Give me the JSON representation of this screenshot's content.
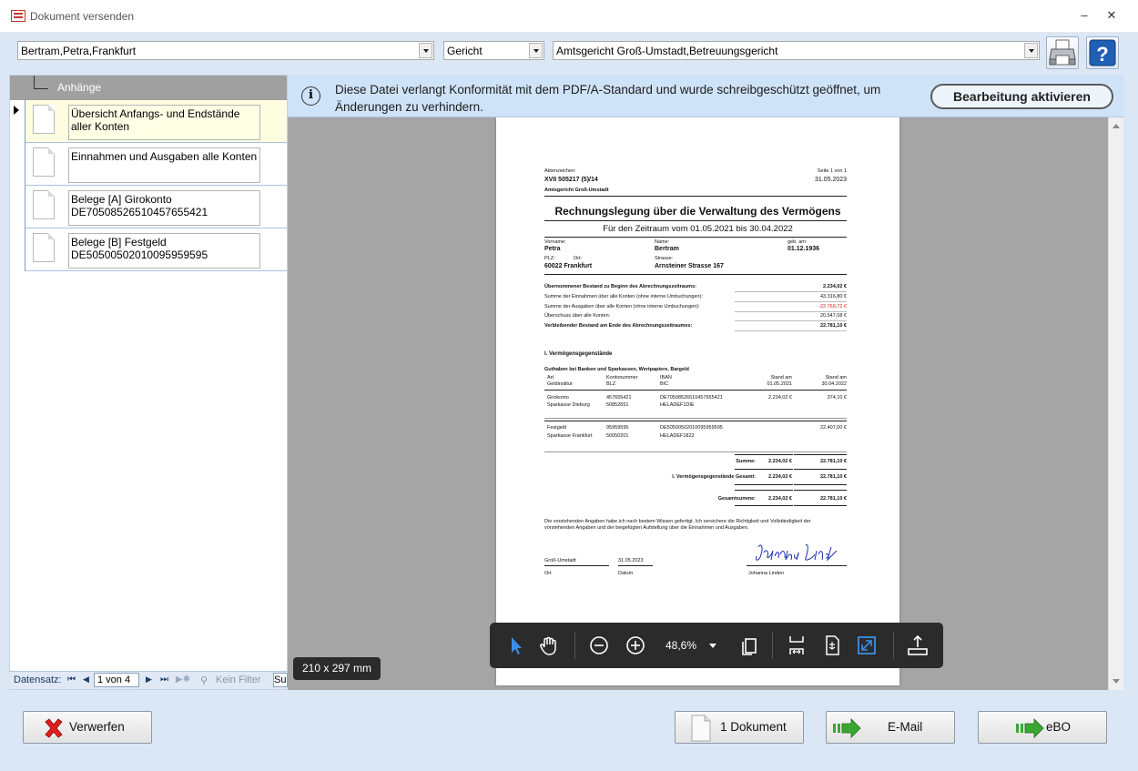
{
  "window": {
    "title": "Dokument versenden",
    "minimize": "–",
    "close": "✕"
  },
  "top": {
    "person": "Bertram,Petra,Frankfurt",
    "type": "Gericht",
    "court": "Amtsgericht Groß-Umstadt,Betreuungsgericht"
  },
  "attachments": {
    "header": "Anhänge",
    "items": [
      {
        "label": "Übersicht Anfangs- und Endstände aller Konten"
      },
      {
        "label": "Einnahmen und Ausgaben alle Konten"
      },
      {
        "label": "Belege [A] Girokonto DE70508526510457655421"
      },
      {
        "label": "Belege [B] Festgeld DE50500502010095959595"
      }
    ]
  },
  "navigator": {
    "label": "Datensatz:",
    "position": "1 von 4",
    "filter": "Kein Filter",
    "search": "Su"
  },
  "info": {
    "message": "Diese Datei verlangt Konformität mit dem PDF/A-Standard und wurde schreibgeschützt geöffnet, um Änderungen zu verhindern.",
    "button": "Bearbeitung aktivieren"
  },
  "viewer": {
    "page_size": "210 x 297 mm",
    "zoom": "48,6%"
  },
  "document": {
    "ref_label": "Aktenzeichen:",
    "ref": "XVII 505217 (5)/14",
    "court": "Amtsgericht Groß-Umstadt",
    "page": "Seite 1 von 1",
    "date": "31.05.2023",
    "title": "Rechnungslegung über die Verwaltung des Vermögens",
    "period": "Für den Zeitraum vom 01.05.2021 bis 30.04.2022",
    "first_name_label": "Vorname:",
    "first_name": "Petra",
    "last_name_label": "Name:",
    "last_name": "Bertram",
    "birth_label": "geb. am:",
    "birth": "01.12.1936",
    "plz_label": "PLZ:",
    "ort_label": "Ort:",
    "street_label": "Strasse:",
    "plz_city": "60022   Frankfurt",
    "street": "Arnsteiner Strasse 167",
    "summary": [
      {
        "label": "Übernommener Bestand zu Beginn des Abrechnungszeitraums:",
        "value": "2.234,02 €",
        "bold": true,
        "red": false
      },
      {
        "label": "Summe der Einnahmen über alle Konten (ohne interne Umbuchungen):",
        "value": "43.316,80 €",
        "bold": false,
        "red": false
      },
      {
        "label": "Summe der Ausgaben über alle Konten (ohne interne Umbuchungen):",
        "value": "-22.769,72 €",
        "bold": false,
        "red": true
      },
      {
        "label": "Überschuss über alle Konten:",
        "value": "20.547,08 €",
        "bold": false,
        "red": false
      },
      {
        "label": "Verbleibender Bestand am Ende des Abrechnungszeitraumes:",
        "value": "22.781,10 €",
        "bold": true,
        "red": false
      }
    ],
    "section1": "I. Vermögensgegenstände",
    "section1_sub": "Guthaben bei Banken und Sparkassen, Wertpapiere, Bargeld",
    "col_art": "Art",
    "col_institute": "Geldinstitut",
    "col_account": "Kontonummer",
    "col_blz": "BLZ",
    "col_iban": "IBAN",
    "col_bic": "BIC",
    "col_stand1": "Stand am",
    "col_date1": "01.05.2021",
    "col_stand2": "Stand am",
    "col_date2": "30.04.2022",
    "acc1": {
      "type": "Girokonto",
      "bank": "Sparkasse Dieburg",
      "number": "457655421",
      "blz": "50852651",
      "iban": "DE70508526510457655421",
      "bic": "HELADEF1DIE",
      "start": "2.234,02 €",
      "end": "374,10 €"
    },
    "acc2": {
      "type": "Festgeld",
      "bank": "Sparkasse Frankfurt",
      "number": "95959595",
      "blz": "50050201",
      "iban": "DE50500502010095959595",
      "bic": "HELADEF1822",
      "start": "",
      "end": "22.407,00 €"
    },
    "sum_label": "Summe:",
    "sum_start": "2.234,02 €",
    "sum_end": "22.781,10 €",
    "total1_label": "I. Vermögensgegenstände   Gesamt:",
    "total1_start": "2.234,02 €",
    "total1_end": "22.781,10 €",
    "grand_label": "Gesamtsumme:",
    "grand_start": "2.234,02 €",
    "grand_end": "22.781,10 €",
    "declaration_1": "Die vorstehenden Angaben habe ich nach bestem Wissen gefertigt. Ich versichere die Richtigkeit und Vollständigkeit der",
    "declaration_2": "vorstehenden Angaben und der beigefügten Aufstellung über die Einnahmen und Ausgaben.",
    "sign_place": "Groß-Umstadt",
    "sign_date": "31.05.2023",
    "sign_ort_label": "Ort",
    "sign_datum_label": "Datum",
    "signer": "Johanna Linden"
  },
  "buttons": {
    "discard": "Verwerfen",
    "document": "1 Dokument",
    "email": "E-Mail",
    "ebo": "eBO"
  },
  "colors": {
    "accent": "#1a6fc4",
    "info_bar": "#cfe3f8",
    "viewer_bg": "#a5a5a5"
  }
}
